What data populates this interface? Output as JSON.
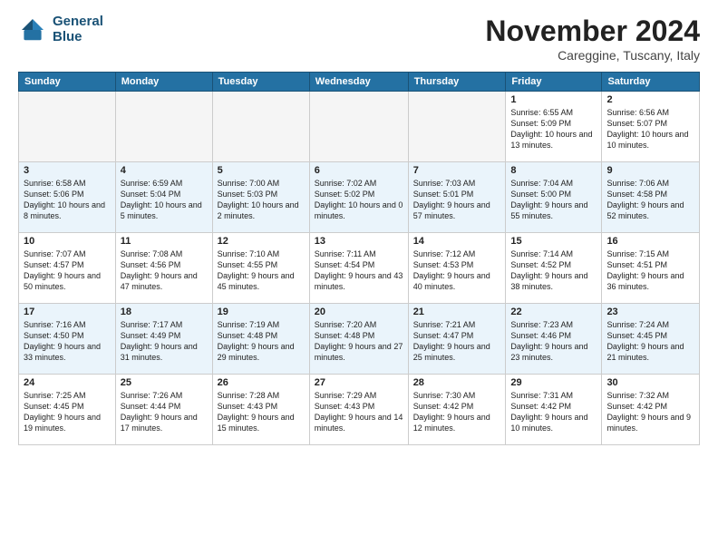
{
  "header": {
    "logo_line1": "General",
    "logo_line2": "Blue",
    "month": "November 2024",
    "location": "Careggine, Tuscany, Italy"
  },
  "weekdays": [
    "Sunday",
    "Monday",
    "Tuesday",
    "Wednesday",
    "Thursday",
    "Friday",
    "Saturday"
  ],
  "weeks": [
    [
      {
        "day": "",
        "info": ""
      },
      {
        "day": "",
        "info": ""
      },
      {
        "day": "",
        "info": ""
      },
      {
        "day": "",
        "info": ""
      },
      {
        "day": "",
        "info": ""
      },
      {
        "day": "1",
        "info": "Sunrise: 6:55 AM\nSunset: 5:09 PM\nDaylight: 10 hours and 13 minutes."
      },
      {
        "day": "2",
        "info": "Sunrise: 6:56 AM\nSunset: 5:07 PM\nDaylight: 10 hours and 10 minutes."
      }
    ],
    [
      {
        "day": "3",
        "info": "Sunrise: 6:58 AM\nSunset: 5:06 PM\nDaylight: 10 hours and 8 minutes."
      },
      {
        "day": "4",
        "info": "Sunrise: 6:59 AM\nSunset: 5:04 PM\nDaylight: 10 hours and 5 minutes."
      },
      {
        "day": "5",
        "info": "Sunrise: 7:00 AM\nSunset: 5:03 PM\nDaylight: 10 hours and 2 minutes."
      },
      {
        "day": "6",
        "info": "Sunrise: 7:02 AM\nSunset: 5:02 PM\nDaylight: 10 hours and 0 minutes."
      },
      {
        "day": "7",
        "info": "Sunrise: 7:03 AM\nSunset: 5:01 PM\nDaylight: 9 hours and 57 minutes."
      },
      {
        "day": "8",
        "info": "Sunrise: 7:04 AM\nSunset: 5:00 PM\nDaylight: 9 hours and 55 minutes."
      },
      {
        "day": "9",
        "info": "Sunrise: 7:06 AM\nSunset: 4:58 PM\nDaylight: 9 hours and 52 minutes."
      }
    ],
    [
      {
        "day": "10",
        "info": "Sunrise: 7:07 AM\nSunset: 4:57 PM\nDaylight: 9 hours and 50 minutes."
      },
      {
        "day": "11",
        "info": "Sunrise: 7:08 AM\nSunset: 4:56 PM\nDaylight: 9 hours and 47 minutes."
      },
      {
        "day": "12",
        "info": "Sunrise: 7:10 AM\nSunset: 4:55 PM\nDaylight: 9 hours and 45 minutes."
      },
      {
        "day": "13",
        "info": "Sunrise: 7:11 AM\nSunset: 4:54 PM\nDaylight: 9 hours and 43 minutes."
      },
      {
        "day": "14",
        "info": "Sunrise: 7:12 AM\nSunset: 4:53 PM\nDaylight: 9 hours and 40 minutes."
      },
      {
        "day": "15",
        "info": "Sunrise: 7:14 AM\nSunset: 4:52 PM\nDaylight: 9 hours and 38 minutes."
      },
      {
        "day": "16",
        "info": "Sunrise: 7:15 AM\nSunset: 4:51 PM\nDaylight: 9 hours and 36 minutes."
      }
    ],
    [
      {
        "day": "17",
        "info": "Sunrise: 7:16 AM\nSunset: 4:50 PM\nDaylight: 9 hours and 33 minutes."
      },
      {
        "day": "18",
        "info": "Sunrise: 7:17 AM\nSunset: 4:49 PM\nDaylight: 9 hours and 31 minutes."
      },
      {
        "day": "19",
        "info": "Sunrise: 7:19 AM\nSunset: 4:48 PM\nDaylight: 9 hours and 29 minutes."
      },
      {
        "day": "20",
        "info": "Sunrise: 7:20 AM\nSunset: 4:48 PM\nDaylight: 9 hours and 27 minutes."
      },
      {
        "day": "21",
        "info": "Sunrise: 7:21 AM\nSunset: 4:47 PM\nDaylight: 9 hours and 25 minutes."
      },
      {
        "day": "22",
        "info": "Sunrise: 7:23 AM\nSunset: 4:46 PM\nDaylight: 9 hours and 23 minutes."
      },
      {
        "day": "23",
        "info": "Sunrise: 7:24 AM\nSunset: 4:45 PM\nDaylight: 9 hours and 21 minutes."
      }
    ],
    [
      {
        "day": "24",
        "info": "Sunrise: 7:25 AM\nSunset: 4:45 PM\nDaylight: 9 hours and 19 minutes."
      },
      {
        "day": "25",
        "info": "Sunrise: 7:26 AM\nSunset: 4:44 PM\nDaylight: 9 hours and 17 minutes."
      },
      {
        "day": "26",
        "info": "Sunrise: 7:28 AM\nSunset: 4:43 PM\nDaylight: 9 hours and 15 minutes."
      },
      {
        "day": "27",
        "info": "Sunrise: 7:29 AM\nSunset: 4:43 PM\nDaylight: 9 hours and 14 minutes."
      },
      {
        "day": "28",
        "info": "Sunrise: 7:30 AM\nSunset: 4:42 PM\nDaylight: 9 hours and 12 minutes."
      },
      {
        "day": "29",
        "info": "Sunrise: 7:31 AM\nSunset: 4:42 PM\nDaylight: 9 hours and 10 minutes."
      },
      {
        "day": "30",
        "info": "Sunrise: 7:32 AM\nSunset: 4:42 PM\nDaylight: 9 hours and 9 minutes."
      }
    ]
  ]
}
